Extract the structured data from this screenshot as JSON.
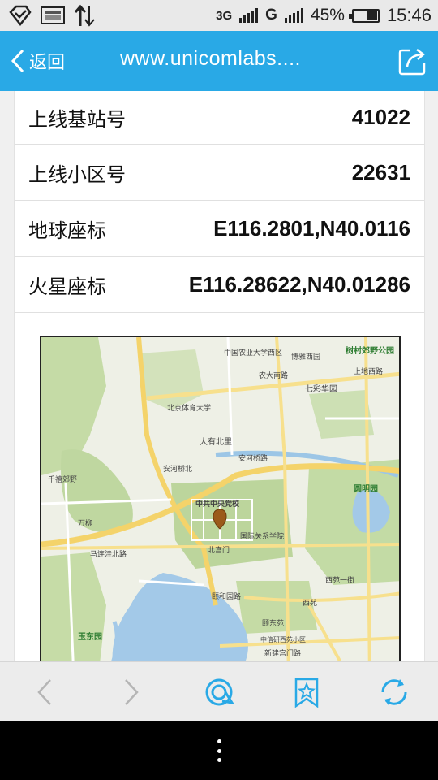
{
  "status_bar": {
    "network_type": "3G",
    "network_letter": "G",
    "battery": "45%",
    "time": "15:46",
    "battery_level": 0.45,
    "icons": [
      "notification-app-icon",
      "image-icon",
      "data-transfer-icon",
      "signal-icon",
      "battery-icon"
    ]
  },
  "title_bar": {
    "back_label": "返回",
    "url": "www.unicomlabs....",
    "accent_color": "#29a9e6"
  },
  "info_rows": [
    {
      "label": "上线基站号",
      "value": "41022"
    },
    {
      "label": "上线小区号",
      "value": "22631"
    },
    {
      "label": "地球座标",
      "value": "E116.2801,N40.0116"
    },
    {
      "label": "火星座标",
      "value": "E116.28622,N40.01286"
    }
  ],
  "map": {
    "labels": {
      "a": "中国农业大学西区",
      "b": "博雅西园",
      "c": "树村郊野公园",
      "d": "农大南路",
      "e": "七彩华园",
      "f": "上地西路",
      "g": "北京体育大学",
      "h": "圆明园",
      "i": "大有北里",
      "j": "安河桥北",
      "k": "中共中央党校",
      "l": "国际关系学院",
      "m": "北宫门",
      "n": "颐东苑",
      "o": "玉东园",
      "p": "西苑",
      "q": "千禧郊野",
      "r": "万柳",
      "s": "中信研西苑小区",
      "t": "新建宫门路",
      "u": "安河桥路",
      "v": "颐和园路",
      "w": "西苑一街",
      "x": "马连洼北路"
    },
    "marker_icon": "location-pin-icon"
  },
  "toolbar": {
    "icons": [
      "back-arrow-icon",
      "forward-arrow-icon",
      "home-swirl-icon",
      "bookmark-star-icon",
      "refresh-icon"
    ]
  },
  "nav_bar": {
    "menu_icon": "overflow-menu-icon"
  }
}
